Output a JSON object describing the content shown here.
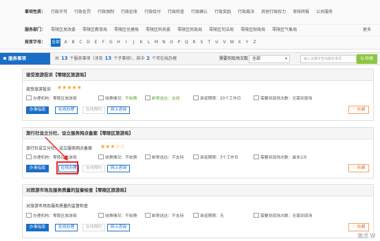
{
  "filters": {
    "topic_label": "事项性质：",
    "topics": [
      "行政许可",
      "行政处罚",
      "行政强制",
      "行政征收",
      "行政给付",
      "行政检查",
      "行政确认",
      "行政奖励",
      "行政裁决",
      "其他行政权力",
      "审核转报",
      "公共服务"
    ],
    "dept_label": "服务部门：",
    "depts": [
      "零陵区发改委",
      "零陵区教育局",
      "零陵区住建局",
      "零陵区科技委",
      "零陵区民政局",
      "零陵区司法局",
      "零陵区财政局",
      "零陵区气象局"
    ],
    "dept_more": "更多",
    "letter_label": "按首字母：",
    "letters": [
      "全部",
      "A",
      "B",
      "C",
      "D",
      "E",
      "F",
      "G",
      "H",
      "I",
      "J",
      "K",
      "L",
      "M",
      "N",
      "O",
      "P",
      "Q",
      "R",
      "S",
      "T",
      "U",
      "V",
      "W",
      "X",
      "Y",
      "Z"
    ]
  },
  "bar": {
    "tab": "服务事项",
    "count_prefix": "共",
    "count_main": "13",
    "count_mid1": "个服务事项（涉及",
    "count_sub": "13",
    "count_mid2": "个子事项），其中",
    "count_online": "2",
    "count_suffix": "个可在线办理",
    "visits_label": "需要到现场次数：",
    "visits_value": "全部",
    "search_placeholder": "输入关键字查找服务事项",
    "search_button": "Q 检索"
  },
  "cards": [
    {
      "title": "接受旅游投诉【零陵区旅游局】",
      "item": "接受旅游投诉",
      "stars": "★★★★★",
      "agency": "办理机构：零陵区旅游局",
      "fee": "收费情况：",
      "fee_value": "不收费",
      "mail": "邮寄送达：支持",
      "limit": "承诺期限：20个工作日",
      "visits": "需要到现场次数：无需到现场",
      "btn_guide": "办事指南",
      "btn_online": "在线办理",
      "btn_reserve": "在线预约",
      "btn_consult": "网上咨询",
      "fav": "♡ 收藏"
    },
    {
      "title": "旅行社设立分社、设立服务网点备案【零陵区旅游局】",
      "item": "旅行社设立分社、设立服务网点备案",
      "stars": "★★★☆☆",
      "agency": "办理机构：零陵区旅游局",
      "fee": "收费情况：",
      "fee_value": "不收费",
      "mail": "邮寄送达：不支持",
      "limit": "承诺期限：3个工作日",
      "visits": "需要到现场次数：最多2次",
      "btn_guide": "办事指南",
      "btn_online": "在线办理",
      "btn_reserve": "在线预约",
      "btn_consult": "网上咨询",
      "fav": "♡ 收藏"
    },
    {
      "title": "对旅游市场及服务质量的监督检查【零陵区旅游局】",
      "item": "对旅游市场及服务质量的监督检查",
      "agency": "办理机构：零陵区旅游局",
      "fee": "收费情况：",
      "fee_value": "不收费",
      "mail": "邮寄送达：不支持",
      "limit": "承诺期限：无",
      "visits": "需要到现场次数：无需到现场",
      "btn_guide": "办事指南",
      "btn_online": "在线办理",
      "btn_reserve": "在线预约",
      "btn_consult": "网上咨询",
      "fav": "♡ 收藏"
    }
  ],
  "watermark": "激活 W",
  "colors": {
    "accent": "#1a6ec6",
    "search_button": "#8cc63f",
    "star": "#f5a623",
    "annotation": "#e22222"
  }
}
